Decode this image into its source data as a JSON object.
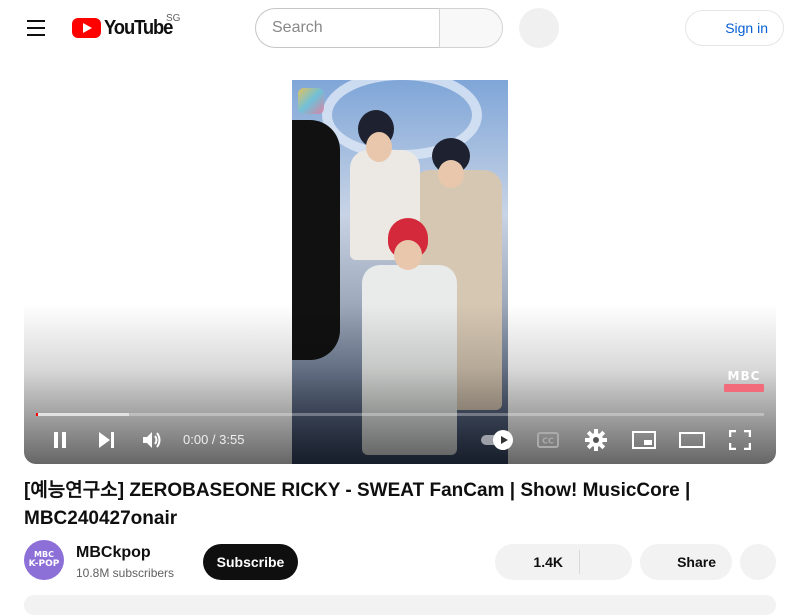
{
  "masthead": {
    "logo_text": "YouTube",
    "country_code": "SG",
    "search_placeholder": "Search",
    "sign_in_label": "Sign in"
  },
  "player": {
    "time_display": "0:00 / 3:55",
    "progress_played_fraction": 0.002,
    "progress_buffered_fraction": 0.128,
    "is_playing": true,
    "watermark": "MBC",
    "controls": {
      "play_pause": "pause-icon",
      "next": "next-icon",
      "volume": "volume-icon",
      "autoplay": "autoplay-toggle",
      "captions": "cc-icon",
      "settings": "gear-icon",
      "miniplayer": "miniplayer-icon",
      "theater": "theater-icon",
      "fullscreen": "fullscreen-icon"
    }
  },
  "video": {
    "title": "[예능연구소] ZEROBASEONE RICKY - SWEAT FanCam | Show! MusicCore | MBC240427onair"
  },
  "channel": {
    "name": "MBCkpop",
    "subscribers": "10.8M subscribers",
    "avatar_line1": "MBC",
    "avatar_line2": "K-POP",
    "subscribe_label": "Subscribe"
  },
  "actions": {
    "like_count": "1.4K",
    "share_label": "Share"
  },
  "colors": {
    "brand_red": "#ff0000",
    "link_blue": "#065fd4",
    "avatar_purple": "#8d6fd8"
  }
}
